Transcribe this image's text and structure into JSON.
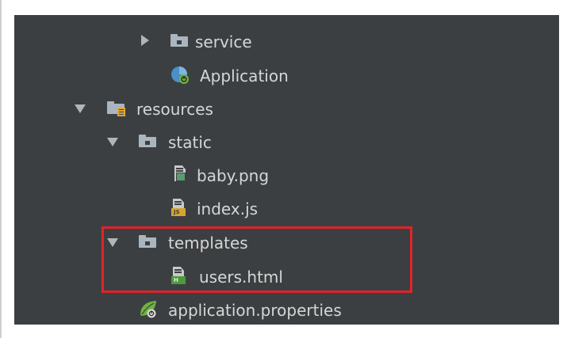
{
  "tree": {
    "items": [
      {
        "label": "service",
        "icon": "folder-icon",
        "expand": "collapsed"
      },
      {
        "label": "Application",
        "icon": "spring-boot-class-icon",
        "expand": "none"
      },
      {
        "label": "resources",
        "icon": "resources-folder-icon",
        "expand": "expanded"
      },
      {
        "label": "static",
        "icon": "folder-icon",
        "expand": "expanded"
      },
      {
        "label": "baby.png",
        "icon": "image-file-icon",
        "expand": "none"
      },
      {
        "label": "index.js",
        "icon": "javascript-file-icon",
        "expand": "none"
      },
      {
        "label": "templates",
        "icon": "folder-icon",
        "expand": "expanded"
      },
      {
        "label": "users.html",
        "icon": "html-file-icon",
        "expand": "none"
      },
      {
        "label": "application.properties",
        "icon": "spring-properties-icon",
        "expand": "none"
      }
    ]
  },
  "icon_tags": {
    "js": "JS",
    "html": "H"
  },
  "colors": {
    "panel_background": "#3c3f41",
    "text": "#d6d6d6",
    "highlight_border": "#e0242b",
    "folder": "#a9b6bf",
    "resources_badge": "#e0a63a",
    "js_tag": "#d6a531",
    "html_tag": "#4e9a3e",
    "spring_green": "#6db33f"
  }
}
